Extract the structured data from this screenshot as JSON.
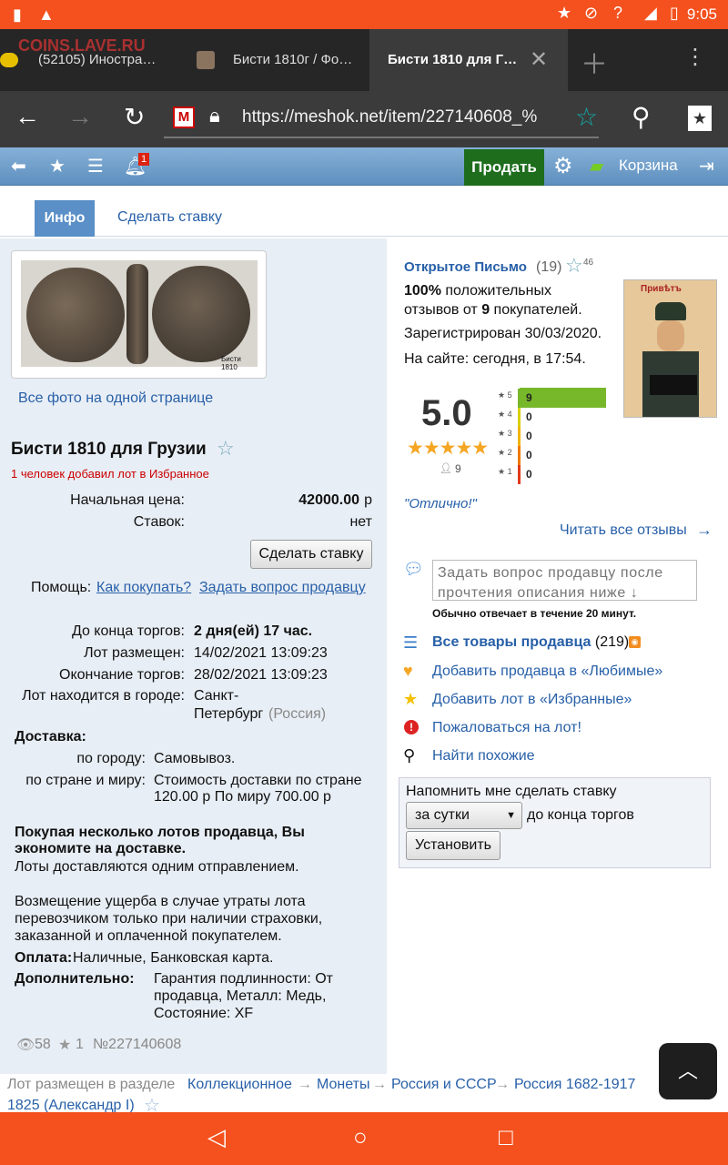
{
  "status": {
    "time": "9:05"
  },
  "tabs": [
    {
      "label": "(52105) Иностра…",
      "overlay": "COINS.LAVE.RU"
    },
    {
      "label": "Бисти 1810г / Фо…"
    },
    {
      "label": "Бисти 1810 для Г…"
    }
  ],
  "url": "https://meshok.net/item/227140608_%",
  "site": {
    "notif_count": "1",
    "sell": "Продать",
    "cart": "Корзина"
  },
  "subtabs": {
    "info": "Инфо",
    "bid": "Сделать ставку"
  },
  "photo": {
    "caption": "Бисти 1810",
    "all_photos": "Все фото на одной странице"
  },
  "lot": {
    "title": "Бисти 1810 для Грузии",
    "fav_note": "1 человек добавил лот в Избранное",
    "start_price_label": "Начальная цена:",
    "start_price": "42000.00",
    "currency": "р",
    "bids_label": "Ставок:",
    "bids": "нет",
    "bid_button": "Сделать ставку",
    "help_label": "Помощь:",
    "help_how": "Как покупать?",
    "help_ask": "Задать вопрос продавцу",
    "end_label": "До конца торгов:",
    "end_value": "2 дня(ей) 17 час.",
    "placed_label": "Лот размещен:",
    "placed_value": "14/02/2021 13:09:23",
    "finish_label": "Окончание торгов:",
    "finish_value": "28/02/2021 13:09:23",
    "city_label": "Лот находится в городе:",
    "city_value1": "Санкт-",
    "city_value2": "Петербург",
    "city_country": "(Россия)",
    "delivery_label": "Доставка:",
    "city_deliv_label": "по городу:",
    "city_deliv_value": "Самовывоз.",
    "world_deliv_label": "по стране и миру:",
    "world_deliv_1": "Стоимость доставки по стране",
    "world_deliv_2": "120.00 р По миру 700.00 р",
    "multi_1": "Покупая несколько лотов продавца, Вы",
    "multi_2": "экономите на доставке.",
    "multi_3": "Лоты доставляются одним отправлением.",
    "damage_1": "Возмещение ущерба в случае утраты лота",
    "damage_2": "перевозчиком только при наличии страховки,",
    "damage_3": "заказанной и оплаченной покупателем.",
    "pay_label": "Оплата:",
    "pay_value": "Наличные, Банковская карта.",
    "extra_label": "Дополнительно:",
    "extra_1": "Гарантия подлинности: От",
    "extra_2": "продавца, Металл: Медь,",
    "extra_3": "Состояние: XF",
    "views": "58",
    "favs": "1",
    "number": "№227140608",
    "section_label": "Лот размещен в разделе",
    "crumbs": [
      "Коллекционное",
      "Монеты",
      "Россия и СССР",
      "Россия 1682-1917"
    ],
    "crumb_last": "1825 (Александр I)"
  },
  "seller": {
    "name": "Открытое Письмо",
    "count": "(19)",
    "stars": "46",
    "pos_1a": "100%",
    "pos_1b": " положительных",
    "pos_2a": "отзывов от ",
    "pos_2b": "9",
    "pos_2c": " покупателей.",
    "registered": "Зарегистрирован 30/03/2020.",
    "online": "На сайте: сегодня, в 17:54.",
    "rating": "5.0",
    "rating_stars": "★★★★★",
    "voters": "9",
    "rows": [
      {
        "label": "5",
        "count": "9",
        "frac": 1.0
      },
      {
        "label": "4",
        "count": "0",
        "frac": 0
      },
      {
        "label": "3",
        "count": "0",
        "frac": 0
      },
      {
        "label": "2",
        "count": "0",
        "frac": 0
      },
      {
        "label": "1",
        "count": "0",
        "frac": 0
      }
    ],
    "quote": "\"Отлично!\"",
    "read_all": "Читать все отзывы",
    "ask_placeholder": "Задать вопрос продавцу после прочтения описания ниже ↓",
    "reply_note": "Обычно отвечает в течение 20 минут.",
    "all_goods": "Все товары продавца",
    "all_goods_count": "(219)",
    "add_fav_seller": "Добавить продавца в «Любимые»",
    "add_fav_lot": "Добавить лот в «Избранные»",
    "complain": "Пожаловаться на лот!",
    "similar": "Найти похожие",
    "reminder_title": "Напомнить мне сделать ставку",
    "reminder_select": "за сутки",
    "reminder_suffix": "до конца торгов",
    "reminder_button": "Установить",
    "avatar_text": "Привѣтъ"
  },
  "colors": {
    "orange": "#f4511e",
    "link": "#2860a8",
    "green": "#77b82a",
    "sitebar": "#6a9acb"
  }
}
